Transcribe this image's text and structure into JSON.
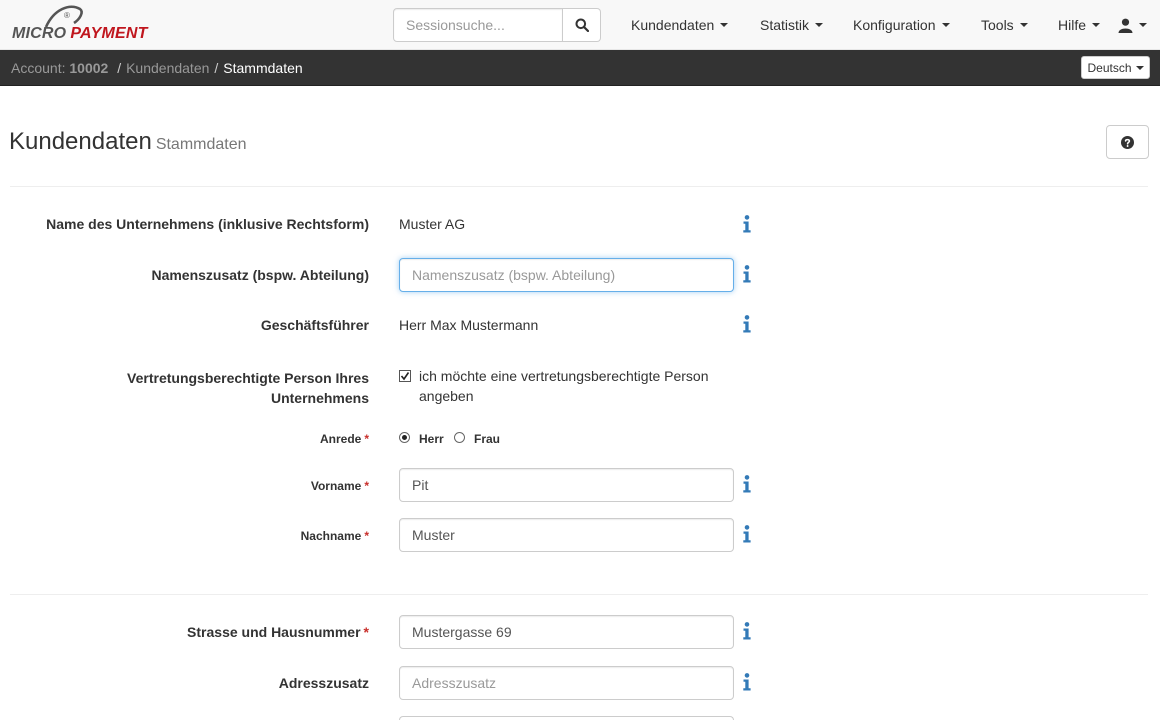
{
  "brand": {
    "logo_part1": "MICRO",
    "logo_part2": "PAYMENT",
    "logo_mark": "®",
    "accent": "#c0161e"
  },
  "search": {
    "placeholder": "Sessionsuche..."
  },
  "nav": [
    {
      "label": "Kundendaten"
    },
    {
      "label": "Statistik"
    },
    {
      "label": "Konfiguration"
    },
    {
      "label": "Tools"
    },
    {
      "label": "Hilfe"
    }
  ],
  "breadcrumb": {
    "account_label": "Account:",
    "account_id": "10002",
    "sep": "/",
    "level1": "Kundendaten",
    "current": "Stammdaten"
  },
  "language": {
    "selected": "Deutsch"
  },
  "page": {
    "title": "Kundendaten",
    "subtitle": "Stammdaten"
  },
  "form": {
    "company": {
      "label": "Name des Unternehmens (inklusive Rechtsform)",
      "value": "Muster AG"
    },
    "name_suffix": {
      "label": "Namenszusatz (bspw. Abteilung)",
      "placeholder": "Namenszusatz (bspw. Abteilung)"
    },
    "ceo": {
      "label": "Geschäftsführer",
      "value": "Herr Max Mustermann"
    },
    "representative": {
      "label_line1": "Vertretungsberechtigte Person Ihres",
      "label_line2": "Unternehmens",
      "checkbox_text": "ich möchte eine vertretungsberechtigte Person angeben",
      "checked": true
    },
    "salutation": {
      "label": "Anrede",
      "options": [
        "Herr",
        "Frau"
      ],
      "selected": "Herr"
    },
    "first_name": {
      "label": "Vorname",
      "value": "Pit"
    },
    "last_name": {
      "label": "Nachname",
      "value": "Muster"
    },
    "street": {
      "label": "Strasse und Hausnummer",
      "value": "Mustergasse 69"
    },
    "address_extra": {
      "label": "Adresszusatz",
      "placeholder": "Adresszusatz"
    },
    "required_mark": "*"
  }
}
